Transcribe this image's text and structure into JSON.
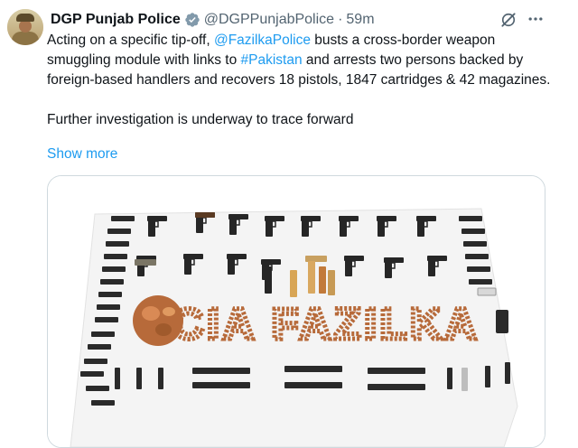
{
  "tweet": {
    "author_name": "DGP Punjab Police",
    "handle": "@DGPPunjabPolice",
    "separator": "·",
    "time": "59m",
    "text_part1": "Acting on a specific tip-off, ",
    "mention": "@FazilkaPolice",
    "text_part2": " busts a cross-border weapon smuggling module with links to ",
    "hashtag": "#Pakistan",
    "text_part3": " and arrests two persons backed by foreign-based handlers and recovers 18 pistols, 1847 cartridges & 42 magazines.",
    "text_paragraph2": "Further investigation is underway to trace forward",
    "show_more": "Show more"
  },
  "media": {
    "banner_text": "CIA FAZILKA",
    "colors": {
      "cloth": "#f4f4f4",
      "gun": "#262626",
      "cartridge": "#b76a3a",
      "letters": "#b76a3a"
    }
  },
  "icons": {
    "verified": "verified-badge-icon",
    "grok": "grok-icon",
    "more": "more-options-icon"
  },
  "colors": {
    "link": "#1d9bf0",
    "secondary": "#536471",
    "verified": "#829aab"
  }
}
